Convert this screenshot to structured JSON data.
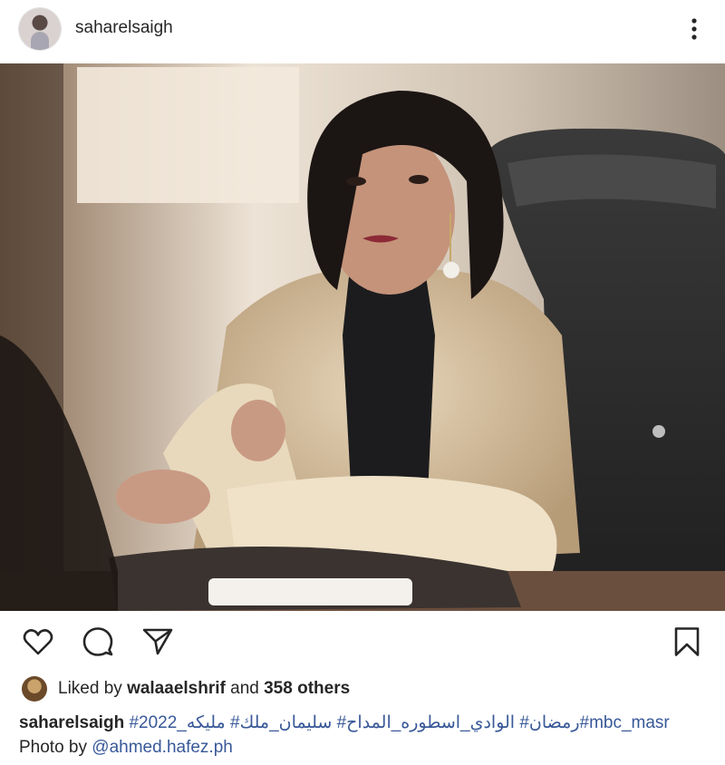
{
  "post": {
    "username": "saharelsaigh",
    "photo_alt": "Photo"
  },
  "icons": {
    "more": "more-vertical-icon",
    "like": "heart-icon",
    "comment": "comment-icon",
    "share": "send-icon",
    "save": "bookmark-icon"
  },
  "likes": {
    "prefix": "Liked by",
    "liker": "walaaelshrif",
    "middle": "and",
    "others": "358 others"
  },
  "caption": {
    "username": "saharelsaigh",
    "hashtags": "#2022_رمضان# الوادي_اسطوره_المداح# سليمان_ملك# مليكه#mbc_masr",
    "line2_prefix": "Photo by",
    "mention": "@ahmed.hafez.ph"
  },
  "colors": {
    "link": "#385898",
    "text": "#262626"
  }
}
